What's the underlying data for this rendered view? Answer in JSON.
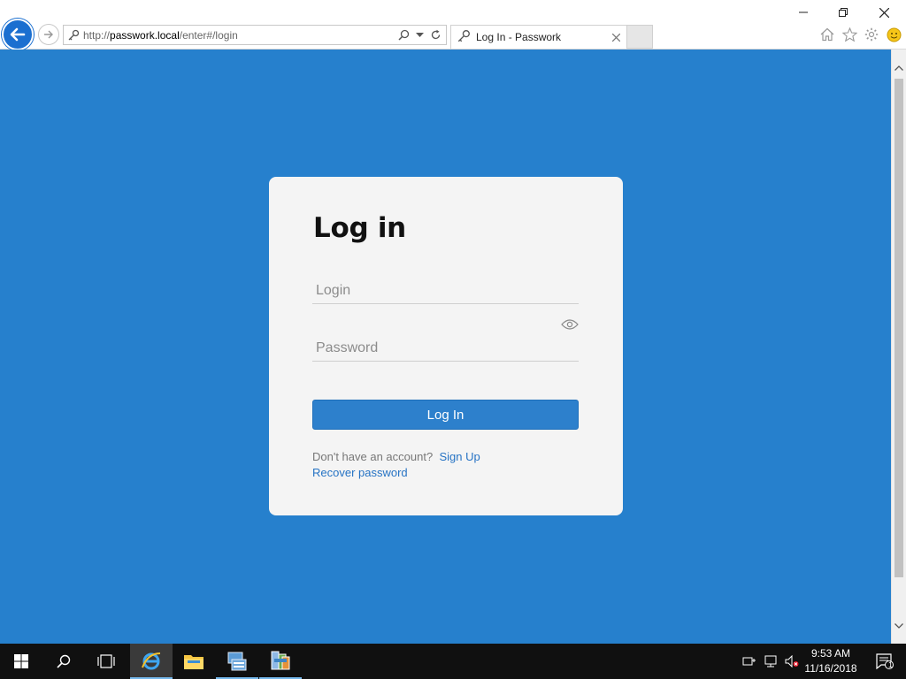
{
  "browser": {
    "url_prefix": "http://",
    "url_host": "passwork.local",
    "url_path": "/enter#/login",
    "tab_title": "Log In - Passwork"
  },
  "page": {
    "heading": "Log in",
    "login_placeholder": "Login",
    "password_placeholder": "Password",
    "login_button": "Log In",
    "no_account_text": "Don't have an account?",
    "signup_link": "Sign Up",
    "recover_link": "Recover password"
  },
  "taskbar": {
    "time": "9:53 AM",
    "date": "11/16/2018",
    "notification_count": "1"
  },
  "colors": {
    "page_background": "#2680cd",
    "accent": "#2d80cc",
    "link": "#2673c4"
  }
}
